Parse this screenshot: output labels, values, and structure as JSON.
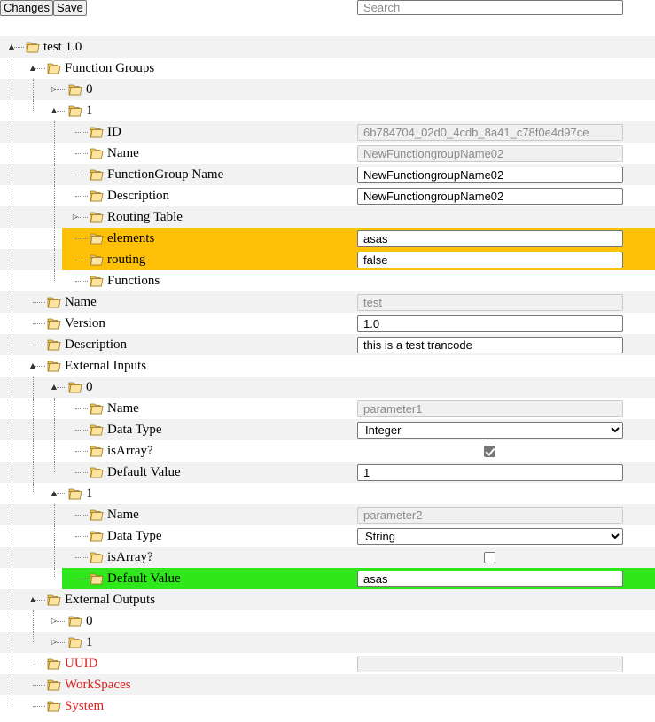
{
  "toolbar": {
    "changes_label": "Changes",
    "save_label": "Save"
  },
  "search": {
    "placeholder": "Search",
    "value": ""
  },
  "icons": {
    "folder": "folder-icon",
    "expander_open": "collapse-icon",
    "expander_closed": "expand-icon"
  },
  "colors": {
    "highlight_orange": "#ffc107",
    "highlight_green": "#2ee81b",
    "error_text": "#e31b1b",
    "row_alt": "#f2f2f2"
  },
  "tree": [
    {
      "label": "test 1.0",
      "depth": 0,
      "expander": "open"
    },
    {
      "label": "Function Groups",
      "depth": 1,
      "expander": "open"
    },
    {
      "label": "0",
      "depth": 2,
      "expander": "closed"
    },
    {
      "label": "1",
      "depth": 2,
      "expander": "open"
    },
    {
      "label": "ID",
      "depth": 3,
      "field": {
        "type": "text",
        "readonly": true,
        "value": "6b784704_02d0_4cdb_8a41_c78f0e4d97ce"
      }
    },
    {
      "label": "Name",
      "depth": 3,
      "field": {
        "type": "text",
        "readonly": true,
        "value": "NewFunctiongroupName02"
      }
    },
    {
      "label": "FunctionGroup Name",
      "depth": 3,
      "field": {
        "type": "text",
        "value": "NewFunctiongroupName02"
      }
    },
    {
      "label": "Description",
      "depth": 3,
      "field": {
        "type": "text",
        "value": "NewFunctiongroupName02"
      }
    },
    {
      "label": "Routing Table",
      "depth": 3,
      "expander": "closed"
    },
    {
      "label": "elements",
      "depth": 3,
      "highlight": "orange",
      "field": {
        "type": "text",
        "value": "asas"
      }
    },
    {
      "label": "routing",
      "depth": 3,
      "highlight": "orange",
      "field": {
        "type": "text",
        "value": "false"
      }
    },
    {
      "label": "Functions",
      "depth": 3
    },
    {
      "label": "Name",
      "depth": 1,
      "field": {
        "type": "text",
        "readonly": true,
        "value": "test"
      }
    },
    {
      "label": "Version",
      "depth": 1,
      "field": {
        "type": "text",
        "value": "1.0"
      }
    },
    {
      "label": "Description",
      "depth": 1,
      "field": {
        "type": "text",
        "value": "this is a test trancode"
      }
    },
    {
      "label": "External Inputs",
      "depth": 1,
      "expander": "open"
    },
    {
      "label": "0",
      "depth": 2,
      "expander": "open"
    },
    {
      "label": "Name",
      "depth": 3,
      "field": {
        "type": "text",
        "readonly": true,
        "value": "parameter1"
      }
    },
    {
      "label": "Data Type",
      "depth": 3,
      "field": {
        "type": "select",
        "value": "Integer"
      }
    },
    {
      "label": "isArray?",
      "depth": 3,
      "field": {
        "type": "checkbox",
        "checked": true
      }
    },
    {
      "label": "Default Value",
      "depth": 3,
      "field": {
        "type": "text",
        "value": "1"
      }
    },
    {
      "label": "1",
      "depth": 2,
      "expander": "open"
    },
    {
      "label": "Name",
      "depth": 3,
      "field": {
        "type": "text",
        "readonly": true,
        "value": "parameter2"
      }
    },
    {
      "label": "Data Type",
      "depth": 3,
      "field": {
        "type": "select",
        "value": "String"
      }
    },
    {
      "label": "isArray?",
      "depth": 3,
      "field": {
        "type": "checkbox",
        "checked": false
      }
    },
    {
      "label": "Default Value",
      "depth": 3,
      "highlight": "green",
      "field": {
        "type": "text",
        "value": "asas"
      }
    },
    {
      "label": "External Outputs",
      "depth": 1,
      "expander": "open"
    },
    {
      "label": "0",
      "depth": 2,
      "expander": "closed"
    },
    {
      "label": "1",
      "depth": 2,
      "expander": "closed"
    },
    {
      "label": "UUID",
      "depth": 1,
      "error": true,
      "field": {
        "type": "text",
        "readonly": true,
        "value": ""
      }
    },
    {
      "label": "WorkSpaces",
      "depth": 1,
      "error": true
    },
    {
      "label": "System",
      "depth": 1,
      "error": true
    }
  ]
}
